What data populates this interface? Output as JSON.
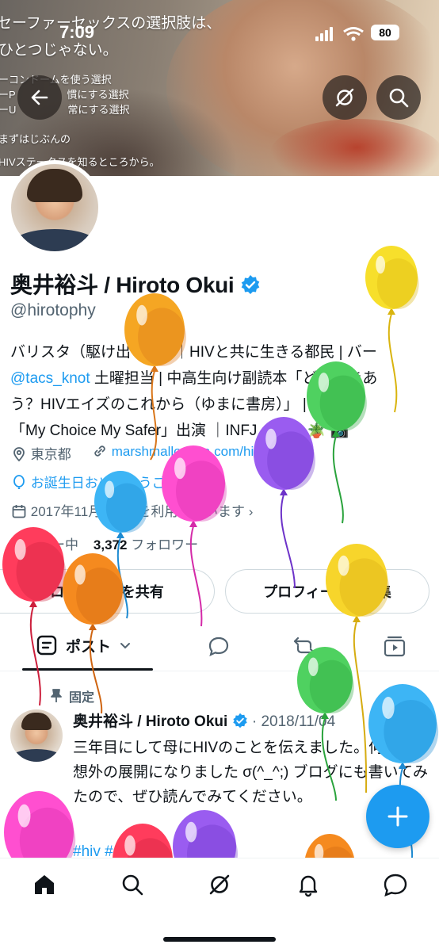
{
  "status_bar": {
    "time": "7:09",
    "battery": "80"
  },
  "banner": {
    "lines": [
      "セーファーセックスの選択肢は、",
      "ひとつじゃない。",
      "ーコンドームを使う選択",
      "ーP　　　　　慣にする選択",
      "ーU　　　　　常にする選択",
      "まずはじぶんの",
      "HIVステータスを知るところから。"
    ]
  },
  "profile": {
    "name": "奥井裕斗 / Hiroto Okui",
    "handle": "@hirotophy",
    "bio_line1": "バリスタ（駆け出し☕）｜HIVと共に生きる都民 | バー",
    "bio_line2_link": "@tacs_knot",
    "bio_line2_rest": " 土曜担当 | 中高生向け副読本「どう向きあ",
    "bio_line3": "う？HIVエイズのこれから（ゆまに書房）」 | akta",
    "bio_line4": "「My Choice My Safer」出演 ｜INFJ 🍰 🍌 🪴 📷",
    "location": "東京都",
    "website": "marshmallow-qa.com/hirotophy",
    "birthday": "お誕生日おめでとうございます。",
    "joined": "2017年11月からXを利用しています",
    "following_count": "",
    "following_label": "フォロー中",
    "followers_count": "3,372",
    "followers_label": "フォロワー"
  },
  "buttons": {
    "share": "ロフィールを共有",
    "edit": "プロフィールを編集"
  },
  "tabs": {
    "posts": "ポスト"
  },
  "post": {
    "pinned_label": "固定",
    "author": "奥井裕斗 / Hiroto Okui",
    "date": "· 2018/11/04",
    "text": "三年目にして母にHIVのことを伝えました。何だか予想外の展開になりました σ(^_^;) ブログにも書いてみたので、ぜひ読んでみてください。",
    "hashtag": "#hiv #"
  },
  "colors": {
    "accent": "#1d9bf0",
    "text": "#0f1419",
    "secondary": "#536471"
  },
  "balloons": [
    {
      "color": "#f5a623",
      "shade": "#d9761a"
    },
    {
      "color": "#f7df2b",
      "shade": "#d9b40f"
    },
    {
      "color": "#4fd160",
      "shade": "#2aa33c"
    },
    {
      "color": "#9a5cf0",
      "shade": "#6d33c9"
    },
    {
      "color": "#ff4fd0",
      "shade": "#d42aa8"
    },
    {
      "color": "#3db5f5",
      "shade": "#1d8ad1"
    },
    {
      "color": "#ff3c5c",
      "shade": "#cc1f3c"
    },
    {
      "color": "#f58a1f",
      "shade": "#cf6410"
    },
    {
      "color": "#f7d52b",
      "shade": "#d6ac10"
    },
    {
      "color": "#4fd160",
      "shade": "#2aa33c"
    },
    {
      "color": "#3db5f5",
      "shade": "#1d8ad1"
    },
    {
      "color": "#ff4fd0",
      "shade": "#d42aa8"
    },
    {
      "color": "#9a5cf0",
      "shade": "#6d33c9"
    },
    {
      "color": "#ff3c5c",
      "shade": "#cc1f3c"
    },
    {
      "color": "#f58a1f",
      "shade": "#cf6410"
    }
  ]
}
